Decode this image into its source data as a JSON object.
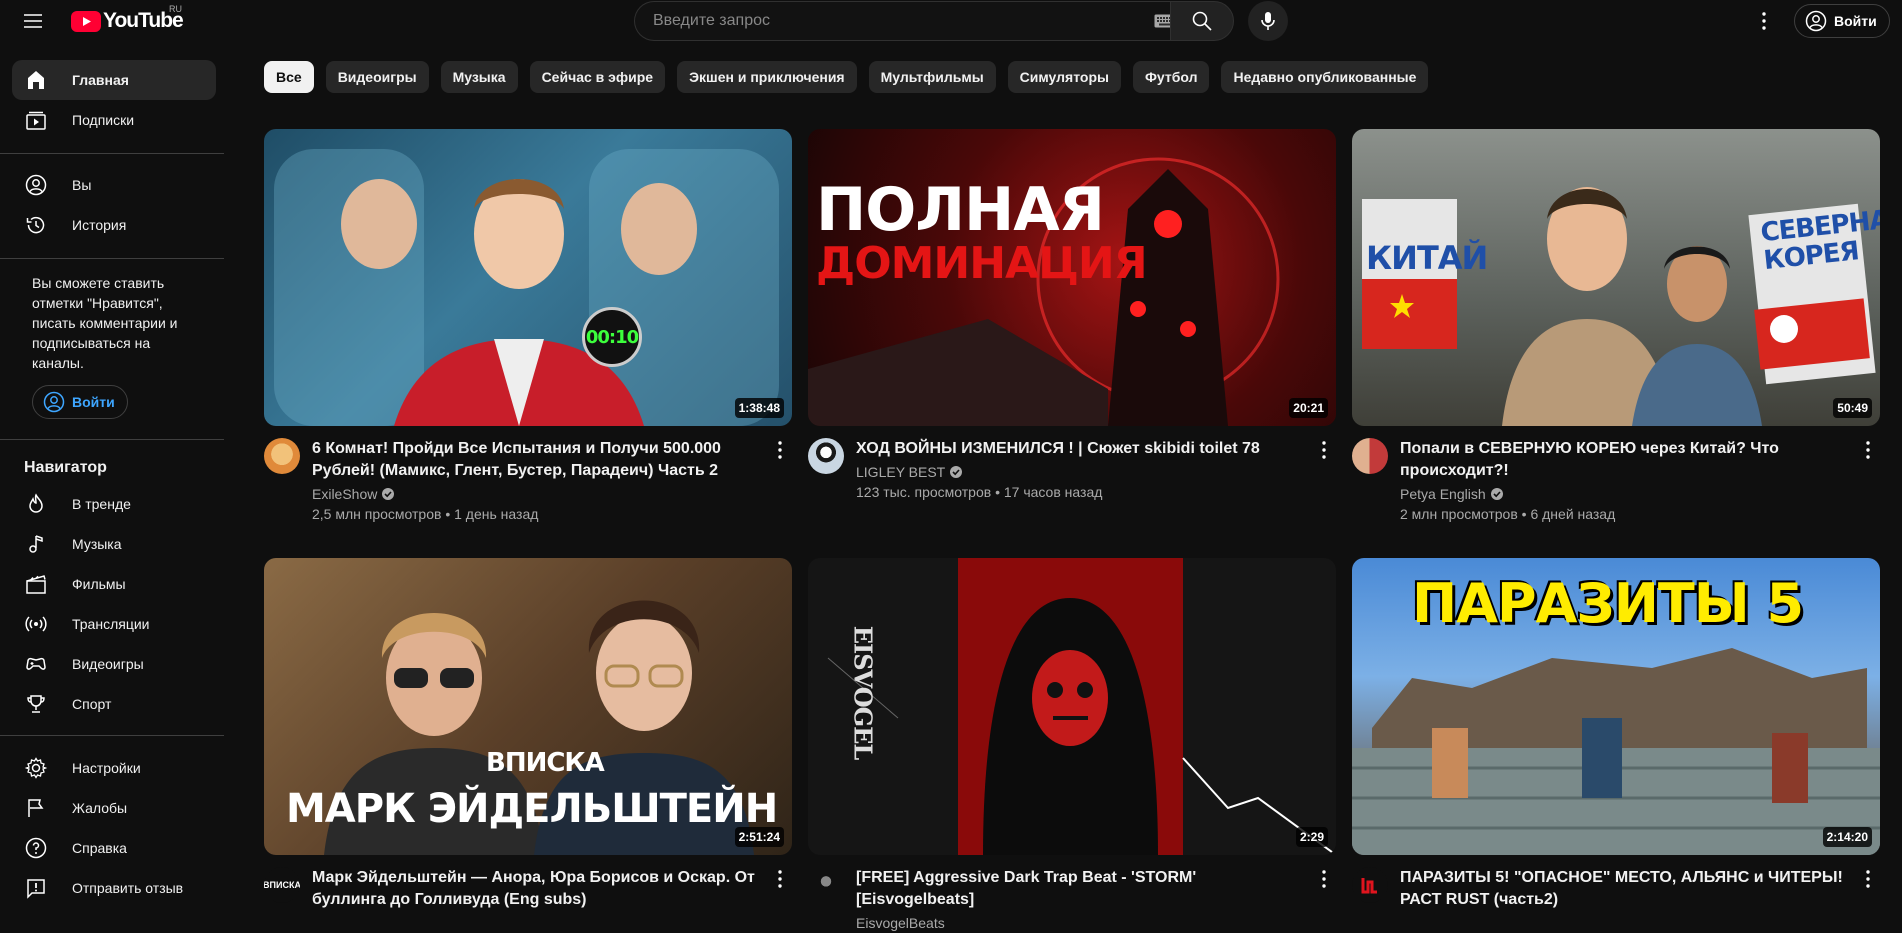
{
  "masthead": {
    "logo_text": "YouTube",
    "region": "RU",
    "search_placeholder": "Введите запрос",
    "signin_label": "Войти"
  },
  "sidebar": {
    "top": [
      {
        "label": "Главная",
        "icon": "home-icon",
        "active": true
      },
      {
        "label": "Подписки",
        "icon": "subscriptions-icon"
      }
    ],
    "you": [
      {
        "label": "Вы",
        "icon": "you-icon"
      },
      {
        "label": "История",
        "icon": "history-icon"
      }
    ],
    "signin_promo": "Вы сможете ставить отметки \"Нравится\", писать комментарии и подписываться на каналы.",
    "signin_label": "Войти",
    "explore_title": "Навигатор",
    "explore": [
      {
        "label": "В тренде",
        "icon": "trending-icon"
      },
      {
        "label": "Музыка",
        "icon": "music-icon"
      },
      {
        "label": "Фильмы",
        "icon": "movies-icon"
      },
      {
        "label": "Трансляции",
        "icon": "live-icon"
      },
      {
        "label": "Видеоигры",
        "icon": "gaming-icon"
      },
      {
        "label": "Спорт",
        "icon": "sports-icon"
      }
    ],
    "bottom": [
      {
        "label": "Настройки",
        "icon": "settings-icon"
      },
      {
        "label": "Жалобы",
        "icon": "flag-icon"
      },
      {
        "label": "Справка",
        "icon": "help-icon"
      },
      {
        "label": "Отправить отзыв",
        "icon": "feedback-icon"
      }
    ]
  },
  "chips": [
    "Все",
    "Видеоигры",
    "Музыка",
    "Сейчас в эфире",
    "Экшен и приключения",
    "Мультфильмы",
    "Симуляторы",
    "Футбол",
    "Недавно опубликованные"
  ],
  "videos": [
    {
      "title": "6 Комнат! Пройди Все Испытания и Получи 500.000 Рублей! (Мамикс, Глент, Бустер, Парадеич) Часть 2",
      "channel": "ExileShow",
      "stats": "2,5 млн просмотров • 1 день назад",
      "duration": "1:38:48",
      "thumb_color": "#3a6f8a",
      "thumb_text": "00:10"
    },
    {
      "title": "ХОД ВОЙНЫ ИЗМЕНИЛСЯ ! | Сюжет skibidi toilet 78",
      "channel": "LIGLEY BEST",
      "stats": "123 тыс. просмотров • 17 часов назад",
      "duration": "20:21",
      "thumb_color": "#5a0c0c",
      "thumb_text_1": "ПОЛНАЯ",
      "thumb_text_2": "ДОМИНАЦИЯ"
    },
    {
      "title": "Попали в СЕВЕРНУЮ КОРЕЮ через Китай? Что происходит?!",
      "channel": "Petya English",
      "stats": "2 млн просмотров • 6 дней назад",
      "duration": "50:49",
      "thumb_color": "#6f756f",
      "thumb_text_1": "КИТАЙ",
      "thumb_text_2": "СЕВЕРНАЯ КОРЕЯ"
    },
    {
      "title": "Марк Эйдельштейн — Анора, Юра Борисов и Оскар. От буллинга до Голливуда (Eng subs)",
      "channel": "ВПИСКА",
      "stats": "",
      "duration": "2:51:24",
      "thumb_color": "#7a5a3a",
      "thumb_text_1": "ВПИСКА",
      "thumb_text_2": "МАРК ЭЙДЕЛЬШТЕЙН"
    },
    {
      "title": "[FREE] Aggressive Dark Trap Beat - 'STORM' [Eisvogelbeats]",
      "channel": "EisvogelBeats",
      "stats": "",
      "duration": "2:29",
      "thumb_color": "#1a1a1a",
      "thumb_text": "EISVOGEL"
    },
    {
      "title": "ПАРАЗИТЫ 5! \"ОПАСНОЕ\" МЕСТО, АЛЬЯНС и ЧИТЕРЫ! РАСТ RUST (часть2)",
      "channel": "",
      "stats": "",
      "duration": "2:14:20",
      "thumb_color": "#4f86c6",
      "thumb_text": "ПАРАЗИТЫ 5"
    }
  ]
}
